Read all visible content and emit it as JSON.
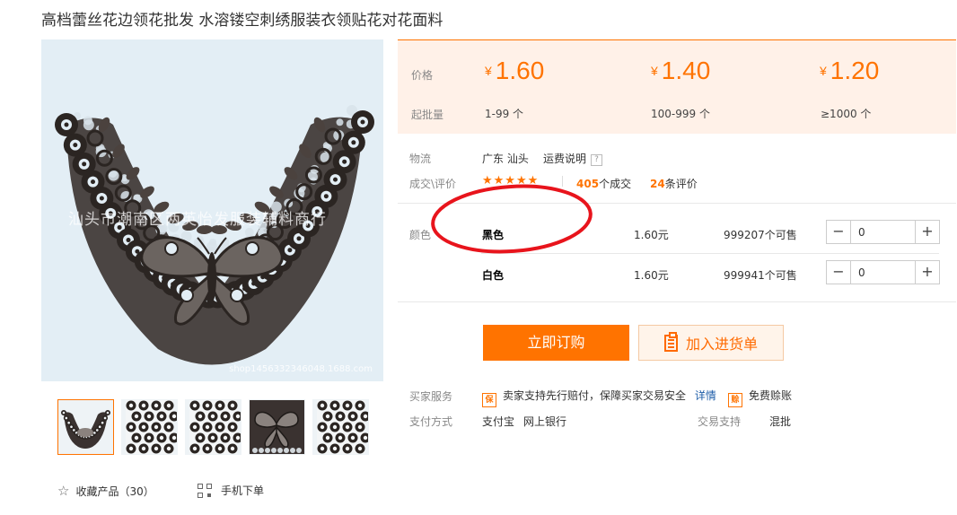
{
  "product": {
    "title": "高档蕾丝花边领花批发 水溶镂空刺绣服装衣领贴花对花面料"
  },
  "gallery": {
    "watermark": "汕头市潮南区两英怡发服装辅料商行",
    "watermark_url": "shop1456332346048.1688.com",
    "thumbnail_count": 5,
    "active_thumbnail": 0
  },
  "actions": {
    "favorite_label": "收藏产品（30）",
    "mobile_order_label": "手机下单"
  },
  "pricing": {
    "price_label": "价格",
    "min_qty_label": "起批量",
    "currency": "¥",
    "tiers": [
      {
        "price": "1.60",
        "qty": "1-99 个"
      },
      {
        "price": "1.40",
        "qty": "100-999 个"
      },
      {
        "price": "1.20",
        "qty": "≥1000 个"
      }
    ]
  },
  "logistics": {
    "label": "物流",
    "origin": "广东 汕头",
    "shipping_link": "运费说明",
    "help": "?"
  },
  "transactions": {
    "label": "成交\\评价",
    "stars": "★★★★★",
    "deal_count": "405",
    "deal_suffix": "个成交",
    "review_count": "24",
    "review_suffix": "条评价"
  },
  "sku": {
    "label": "颜色",
    "rows": [
      {
        "name": "黑色",
        "price": "1.60元",
        "stock": "999207个可售",
        "quantity": "0"
      },
      {
        "name": "白色",
        "price": "1.60元",
        "stock": "999941个可售",
        "quantity": "0"
      }
    ]
  },
  "buttons": {
    "order": "立即订购",
    "add_to_list": "加入进货单"
  },
  "services": {
    "label": "买家服务",
    "badge_text": "保",
    "guarantee": "卖家支持先行赔付，保障买家交易安全",
    "details_link": "详情",
    "credit_badge": "赊",
    "credit_text": "免费赊账"
  },
  "payment": {
    "label": "支付方式",
    "methods": [
      "支付宝",
      "网上银行"
    ],
    "trade_support_label": "交易支持",
    "trade_support_value": "混批"
  },
  "colors": {
    "accent": "#ff7300",
    "annotation": "#e8141c",
    "price_panel_bg": "#fff1e8"
  }
}
